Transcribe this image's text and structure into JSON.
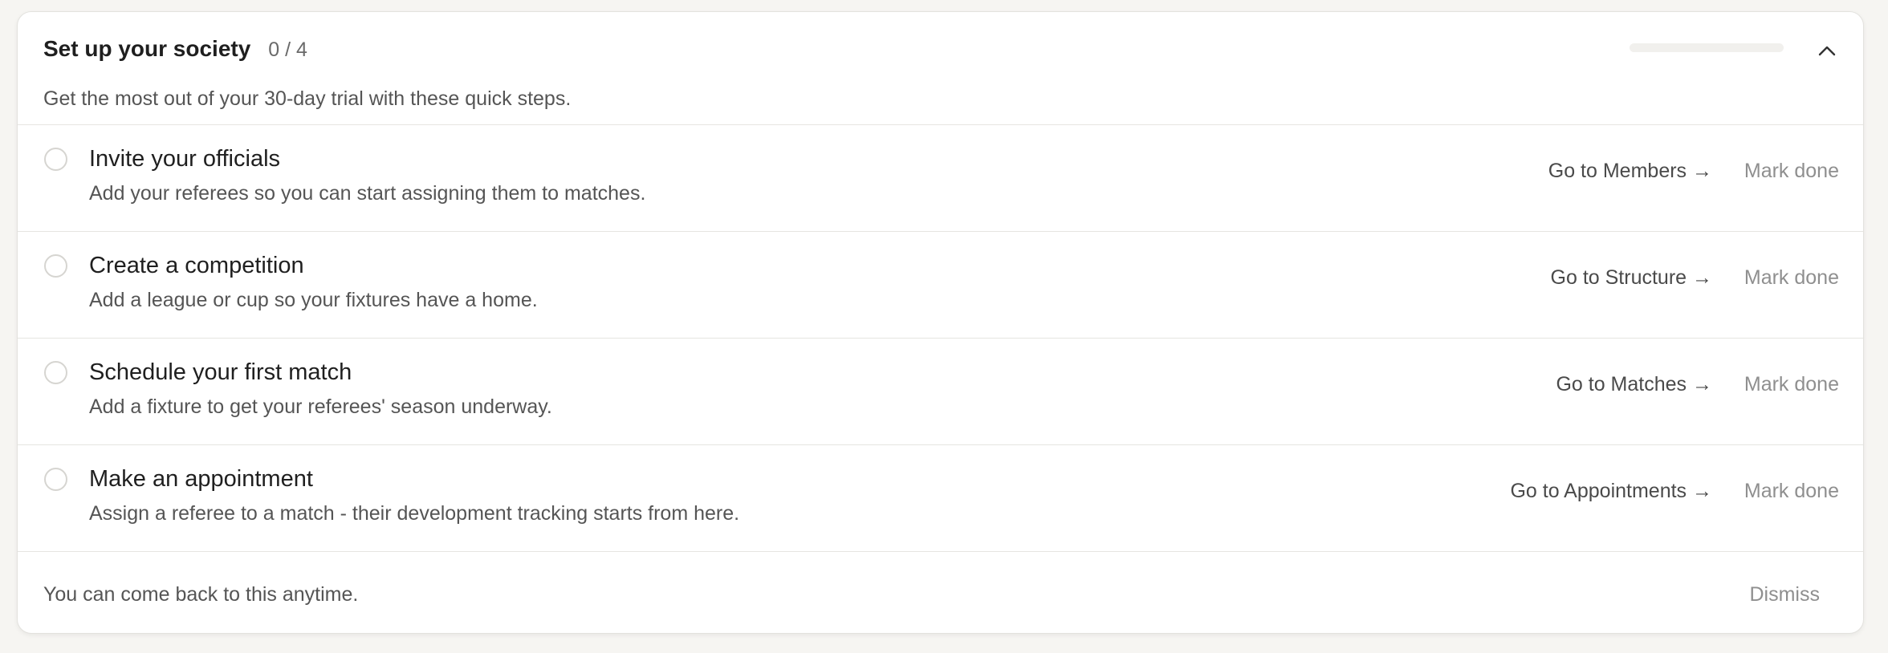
{
  "setup": {
    "title": "Set up your society",
    "count": "0 / 4",
    "subtitle": "Get the most out of your 30-day trial with these quick steps.",
    "progress_fraction": 0,
    "accent_color": "#3a7d44",
    "collapse_icon": "chevron-up-icon"
  },
  "tasks": [
    {
      "title": "Invite your officials",
      "description": "Add your referees so you can start assigning them to matches.",
      "goto_label": "Go to Members →",
      "mark_done_label": "Mark done",
      "done": false
    },
    {
      "title": "Create a competition",
      "description": "Add a league or cup so your fixtures have a home.",
      "goto_label": "Go to Structure →",
      "mark_done_label": "Mark done",
      "done": false
    },
    {
      "title": "Schedule your first match",
      "description": "Add a fixture to get your referees' season underway.",
      "goto_label": "Go to Matches →",
      "mark_done_label": "Mark done",
      "done": false
    },
    {
      "title": "Make an appointment",
      "description": "Assign a referee to a match - their development tracking starts from here.",
      "goto_label": "Go to Appointments →",
      "mark_done_label": "Mark done",
      "done": false
    }
  ],
  "footer": {
    "text": "You can come back to this anytime.",
    "dismiss_label": "Dismiss"
  }
}
